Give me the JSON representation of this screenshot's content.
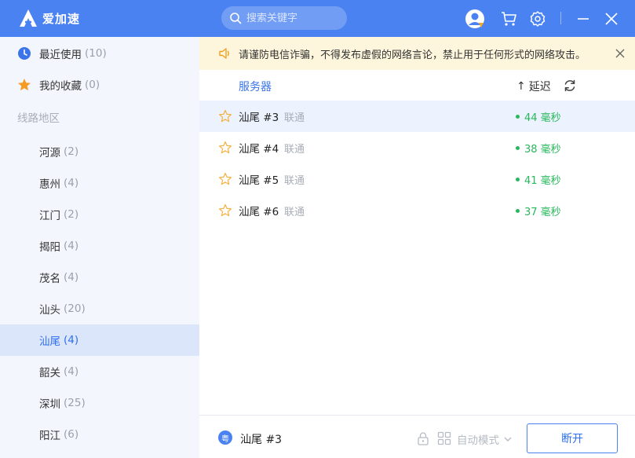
{
  "app": {
    "title": "爱加速"
  },
  "search": {
    "placeholder": "搜索关键字"
  },
  "sidebar": {
    "recent": {
      "label": "最近使用",
      "count": "(10)"
    },
    "favorites": {
      "label": "我的收藏",
      "count": "(0)"
    },
    "section_title": "线路地区",
    "regions": [
      {
        "label": "河源",
        "count": "(2)"
      },
      {
        "label": "惠州",
        "count": "(4)"
      },
      {
        "label": "江门",
        "count": "(2)"
      },
      {
        "label": "揭阳",
        "count": "(4)"
      },
      {
        "label": "茂名",
        "count": "(4)"
      },
      {
        "label": "汕头",
        "count": "(20)"
      },
      {
        "label": "汕尾",
        "count": "(4)"
      },
      {
        "label": "韶关",
        "count": "(4)"
      },
      {
        "label": "深圳",
        "count": "(25)"
      },
      {
        "label": "阳江",
        "count": "(6)"
      }
    ]
  },
  "notice": {
    "text": "请谨防电信诈骗，不得发布虚假的网络言论，禁止用于任何形式的网络攻击。"
  },
  "table": {
    "header_server": "服务器",
    "header_latency": "延迟",
    "sort_arrow": "↑",
    "rows": [
      {
        "name": "汕尾 #3",
        "isp": "联通",
        "latency": "44 毫秒"
      },
      {
        "name": "汕尾 #4",
        "isp": "联通",
        "latency": "38 毫秒"
      },
      {
        "name": "汕尾 #5",
        "isp": "联通",
        "latency": "41 毫秒"
      },
      {
        "name": "汕尾 #6",
        "isp": "联通",
        "latency": "37 毫秒"
      }
    ]
  },
  "footer": {
    "region_badge": "粤",
    "current_server": "汕尾 #3",
    "mode_label": "自动模式",
    "disconnect_label": "断开"
  },
  "colors": {
    "brand": "#4a82f2",
    "accent": "#2e6ff0",
    "latency_good": "#27b85c",
    "notice_bg": "#fdf6dc"
  }
}
